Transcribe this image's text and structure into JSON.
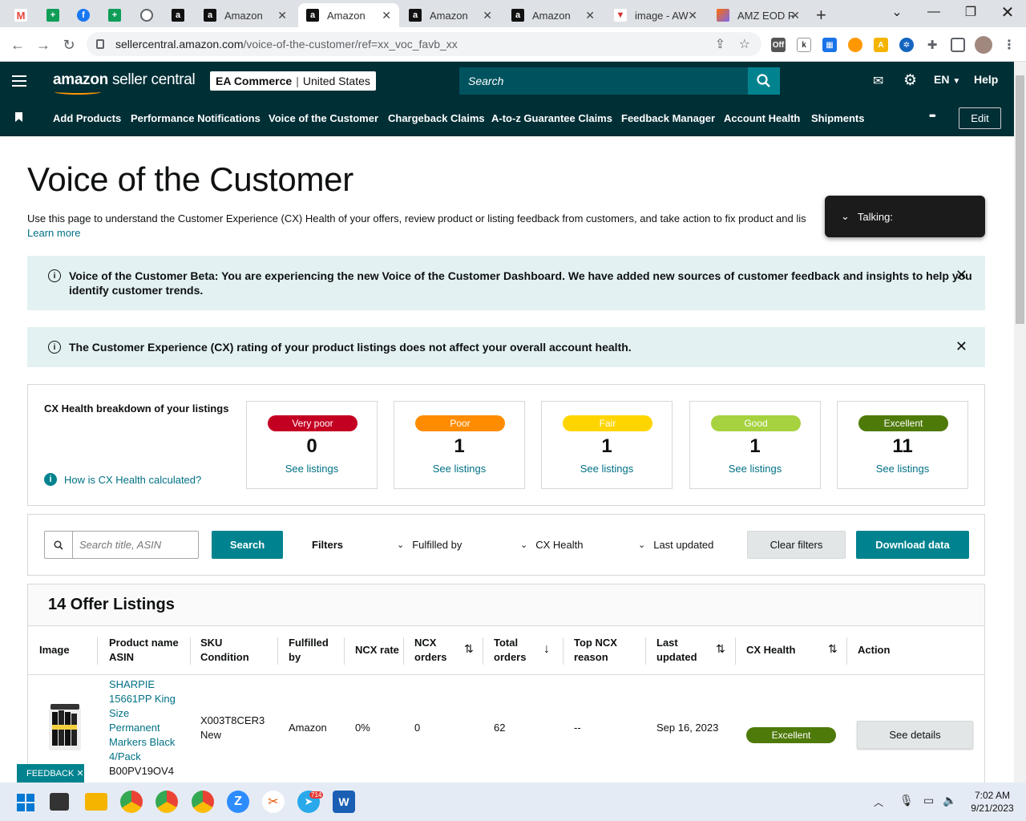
{
  "browser": {
    "tabs": [
      {
        "title": "",
        "icon": "gmail-icon",
        "color": "#ea4335"
      },
      {
        "title": "",
        "icon": "sheets-icon",
        "color": "#0f9d58"
      },
      {
        "title": "",
        "icon": "facebook-icon",
        "color": "#1877f2"
      },
      {
        "title": "",
        "icon": "sheets-icon",
        "color": "#0f9d58"
      },
      {
        "title": "",
        "icon": "globe-icon",
        "color": "#5f6368"
      },
      {
        "title": "",
        "icon": "amazon-icon",
        "color": "#111111"
      },
      {
        "title": "Amazon",
        "icon": "amazon-icon",
        "color": "#111111"
      },
      {
        "title": "Amazon",
        "icon": "amazon-icon",
        "color": "#111111"
      },
      {
        "title": "Amazon",
        "icon": "amazon-icon",
        "color": "#111111"
      },
      {
        "title": "Amazon",
        "icon": "amazon-icon",
        "color": "#111111"
      },
      {
        "title": "image - AW",
        "icon": "vivaldi-icon",
        "color": "#d32f2f"
      },
      {
        "title": "AMZ EOD R",
        "icon": "clickup-icon",
        "color": "#7b68ee"
      }
    ],
    "new_tab": "+",
    "url_host": "sellercentral.amazon.com",
    "url_path": "/voice-of-the-customer/ref=xx_voc_favb_xx"
  },
  "header": {
    "logo_main": "amazon",
    "logo_sub": "seller central",
    "account_name": "EA Commerce",
    "account_region": "United States",
    "search_placeholder": "Search",
    "language": "EN",
    "help": "Help"
  },
  "nav": {
    "items": [
      "Add Products",
      "Performance Notifications",
      "Voice of the Customer",
      "Chargeback Claims",
      "A-to-z Guarantee Claims",
      "Feedback Manager",
      "Account Health",
      "Shipments"
    ],
    "more": "•••",
    "edit": "Edit"
  },
  "page": {
    "title": "Voice of the Customer",
    "description": "Use this page to understand the Customer Experience (CX) Health of your offers, review product or listing feedback from customers, and take action to fix product and lis",
    "learn_more": "Learn more",
    "talking": "Talking:"
  },
  "alerts": {
    "beta_line1": "Voice of the Customer Beta: You are experiencing the new Voice of the Customer Dashboard. We have added new sources of customer feedback and insights to help you",
    "beta_line2": "identify customer trends.",
    "cx_note": "The Customer Experience (CX) rating of your product listings does not affect your overall account health."
  },
  "cx_health": {
    "title": "CX Health breakdown of your listings",
    "how_link": "How is CX Health calculated?",
    "cards": [
      {
        "label": "Very poor",
        "count": "0",
        "link": "See listings",
        "bg": "#c40022",
        "fg": "#ffffff"
      },
      {
        "label": "Poor",
        "count": "1",
        "link": "See listings",
        "bg": "#ff8c00",
        "fg": "#ffffff"
      },
      {
        "label": "Fair",
        "count": "1",
        "link": "See listings",
        "bg": "#ffd500",
        "fg": "#ffffff"
      },
      {
        "label": "Good",
        "count": "1",
        "link": "See listings",
        "bg": "#a6d23f",
        "fg": "#ffffff"
      },
      {
        "label": "Excellent",
        "count": "11",
        "link": "See listings",
        "bg": "#4e7a0a",
        "fg": "#ffffff"
      }
    ]
  },
  "filters": {
    "search_placeholder": "Search title, ASIN",
    "search_button": "Search",
    "filters_label": "Filters",
    "dropdowns": [
      "Fulfilled by",
      "CX Health",
      "Last updated"
    ],
    "clear": "Clear filters",
    "download": "Download data"
  },
  "table": {
    "title": "14 Offer Listings",
    "columns": {
      "image": "Image",
      "product1": "Product name",
      "product2": "ASIN",
      "sku1": "SKU",
      "sku2": "Condition",
      "ful1": "Fulfilled",
      "ful2": "by",
      "ncx_rate": "NCX rate",
      "ncx_orders1": "NCX",
      "ncx_orders2": "orders",
      "total1": "Total",
      "total2": "orders",
      "top1": "Top NCX",
      "top2": "reason",
      "last1": "Last",
      "last2": "updated",
      "cx": "CX Health",
      "action": "Action"
    },
    "row": {
      "name_lines": [
        "SHARPIE",
        "15661PP King",
        "Size",
        "Permanent",
        "Markers Black",
        "4/Pack"
      ],
      "asin": "B00PV19OV4",
      "sku": "X003T8CER3",
      "condition": "New",
      "fulfilled_by": "Amazon",
      "ncx_rate": "0%",
      "ncx_orders": "0",
      "total_orders": "62",
      "top_reason": "--",
      "last_updated": "Sep 16, 2023",
      "cx_health": "Excellent",
      "action": "See details"
    }
  },
  "feedback_tab": "FEEDBACK ✕",
  "taskbar": {
    "time": "7:02 AM",
    "date": "9/21/2023",
    "telegram_badge": "714"
  }
}
